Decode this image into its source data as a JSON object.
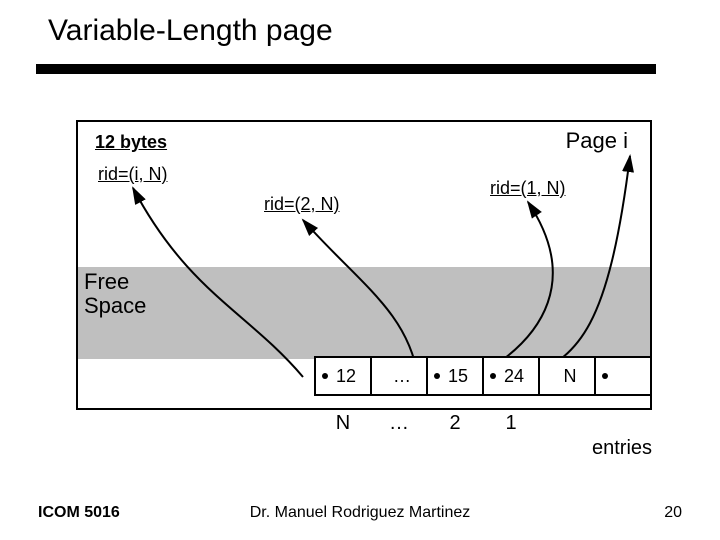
{
  "title": "Variable-Length page",
  "page_label": "Page i",
  "header12": "12 bytes",
  "rid_a": "rid=(i, N)",
  "rid_b": "rid=(2, N)",
  "rid_c": "rid=(1, N)",
  "free_line1": "Free",
  "free_line2": "Space",
  "slots": {
    "s1": "12",
    "s2": "…",
    "s3": "15",
    "s4": "24",
    "s5": "N",
    "s6": ""
  },
  "indices": {
    "i1": "N",
    "i2": "…",
    "i3": "2",
    "i4": "1",
    "i5": "",
    "i6": ""
  },
  "entries_label": "entries",
  "footer": {
    "left": "ICOM 5016",
    "center": "Dr. Manuel Rodriguez Martinez",
    "right": "20"
  }
}
